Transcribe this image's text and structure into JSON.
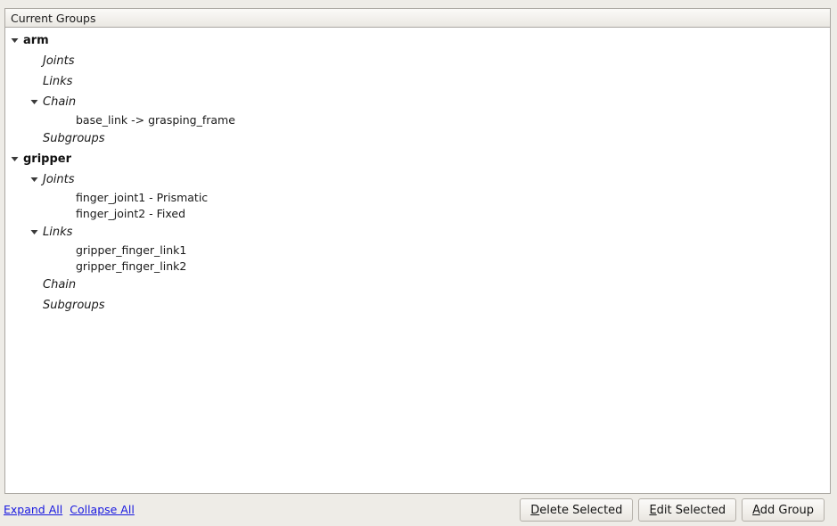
{
  "panel": {
    "header_title": "Current Groups"
  },
  "tree": {
    "rows": [
      {
        "level": "group",
        "label": "arm",
        "twisty": "expanded-triangle-icon",
        "name": "tree-group-arm"
      },
      {
        "level": "cat",
        "label": "Joints",
        "twisty": "none",
        "name": "tree-category-arm-joints"
      },
      {
        "level": "cat",
        "label": "Links",
        "twisty": "none",
        "name": "tree-category-arm-links"
      },
      {
        "level": "cat",
        "label": "Chain",
        "twisty": "expanded-triangle-icon",
        "name": "tree-category-arm-chain"
      },
      {
        "level": "leaf",
        "label": "base_link -> grasping_frame",
        "twisty": "none",
        "name": "tree-leaf-arm-chain-0"
      },
      {
        "level": "cat",
        "label": "Subgroups",
        "twisty": "none",
        "name": "tree-category-arm-subgroups"
      },
      {
        "level": "group",
        "label": "gripper",
        "twisty": "expanded-triangle-icon",
        "name": "tree-group-gripper"
      },
      {
        "level": "cat",
        "label": "Joints",
        "twisty": "expanded-triangle-icon",
        "name": "tree-category-gripper-joints"
      },
      {
        "level": "leaf",
        "label": "finger_joint1 - Prismatic",
        "twisty": "none",
        "name": "tree-leaf-gripper-joint-0"
      },
      {
        "level": "leaf",
        "label": "finger_joint2 - Fixed",
        "twisty": "none",
        "name": "tree-leaf-gripper-joint-1"
      },
      {
        "level": "cat",
        "label": "Links",
        "twisty": "expanded-triangle-icon",
        "name": "tree-category-gripper-links"
      },
      {
        "level": "leaf",
        "label": "gripper_finger_link1",
        "twisty": "none",
        "name": "tree-leaf-gripper-link-0"
      },
      {
        "level": "leaf",
        "label": "gripper_finger_link2",
        "twisty": "none",
        "name": "tree-leaf-gripper-link-1"
      },
      {
        "level": "cat",
        "label": "Chain",
        "twisty": "none",
        "name": "tree-category-gripper-chain"
      },
      {
        "level": "cat",
        "label": "Subgroups",
        "twisty": "none",
        "name": "tree-category-gripper-subgroups"
      }
    ]
  },
  "links": {
    "expand_all": "Expand All",
    "collapse_all": "Collapse All",
    "color": "#1818e0"
  },
  "buttons": [
    {
      "label": "Delete Selected",
      "mnemonic": "D",
      "name": "delete-selected-button"
    },
    {
      "label": "Edit Selected",
      "mnemonic": "E",
      "name": "edit-selected-button"
    },
    {
      "label": "Add Group",
      "mnemonic": "A",
      "name": "add-group-button"
    }
  ],
  "colors": {
    "window_background": "#eeece7",
    "panel_background": "#ffffff",
    "panel_border": "#aaa7a1",
    "text": "#1a1a1a",
    "link": "#1818e0"
  }
}
